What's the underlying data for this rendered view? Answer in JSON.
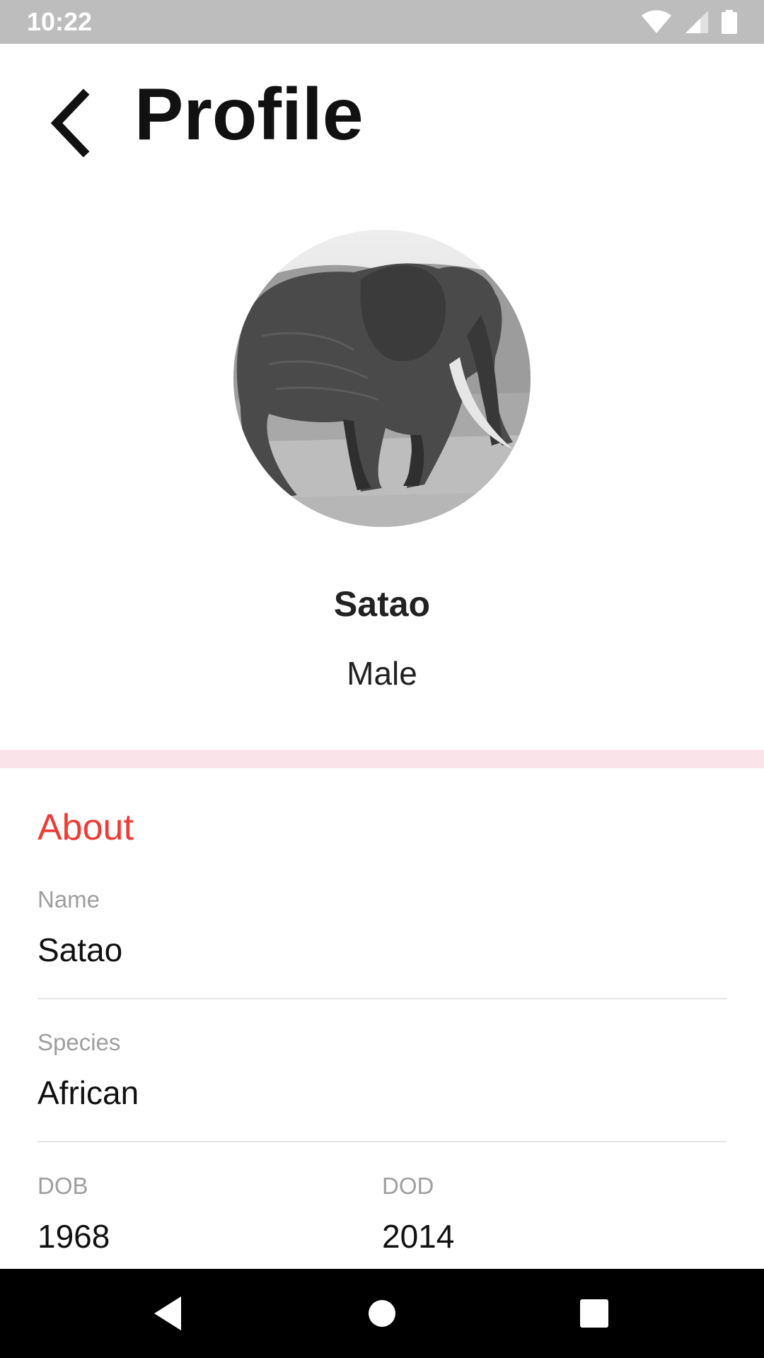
{
  "status_bar": {
    "time": "10:22",
    "icons": [
      "wifi-icon",
      "cell-signal-icon",
      "battery-icon"
    ]
  },
  "app_bar": {
    "title": "Profile",
    "back_icon": "chevron-left-icon"
  },
  "profile": {
    "avatar_alt": "elephant photo",
    "name": "Satao",
    "gender": "Male"
  },
  "about": {
    "title": "About",
    "fields": {
      "name": {
        "label": "Name",
        "value": "Satao"
      },
      "species": {
        "label": "Species",
        "value": "African"
      },
      "dob": {
        "label": "DOB",
        "value": "1968"
      },
      "dod": {
        "label": "DOD",
        "value": "2014"
      }
    }
  },
  "nav_bar": {
    "icons": [
      "back-triangle-icon",
      "home-circle-icon",
      "recents-square-icon"
    ]
  },
  "colors": {
    "accent": "#ef3b36",
    "band": "#fbe3ea",
    "status_bar": "#bdbdbd"
  }
}
